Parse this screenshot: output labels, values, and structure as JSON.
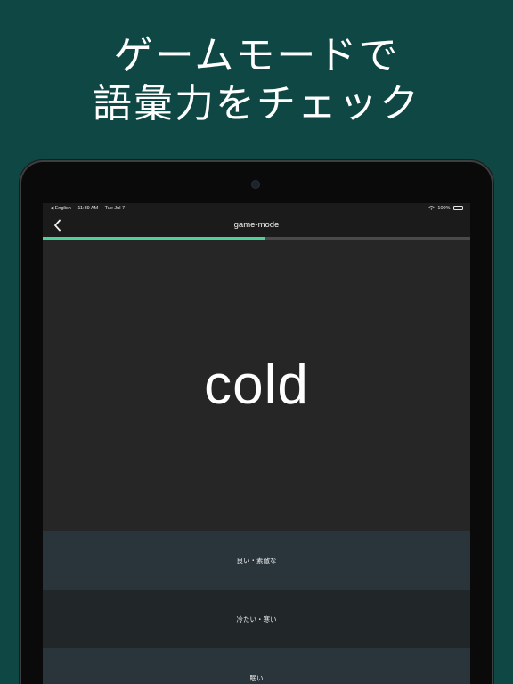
{
  "headline": {
    "line1": "ゲームモードで",
    "line2": "語彙力をチェック"
  },
  "status_bar": {
    "back_app": "◀ English",
    "time": "11:39 AM",
    "date": "Tue Jul 7",
    "battery": "100%"
  },
  "nav": {
    "title": "game-mode"
  },
  "progress": {
    "fraction": 0.52
  },
  "question": {
    "word": "cold"
  },
  "options": [
    "良い・素敵な",
    "冷たい・寒い",
    "眠い"
  ],
  "colors": {
    "background": "#0e4744",
    "progress": "#4fd19a",
    "option_a": "#29353b",
    "option_b": "#212729"
  }
}
